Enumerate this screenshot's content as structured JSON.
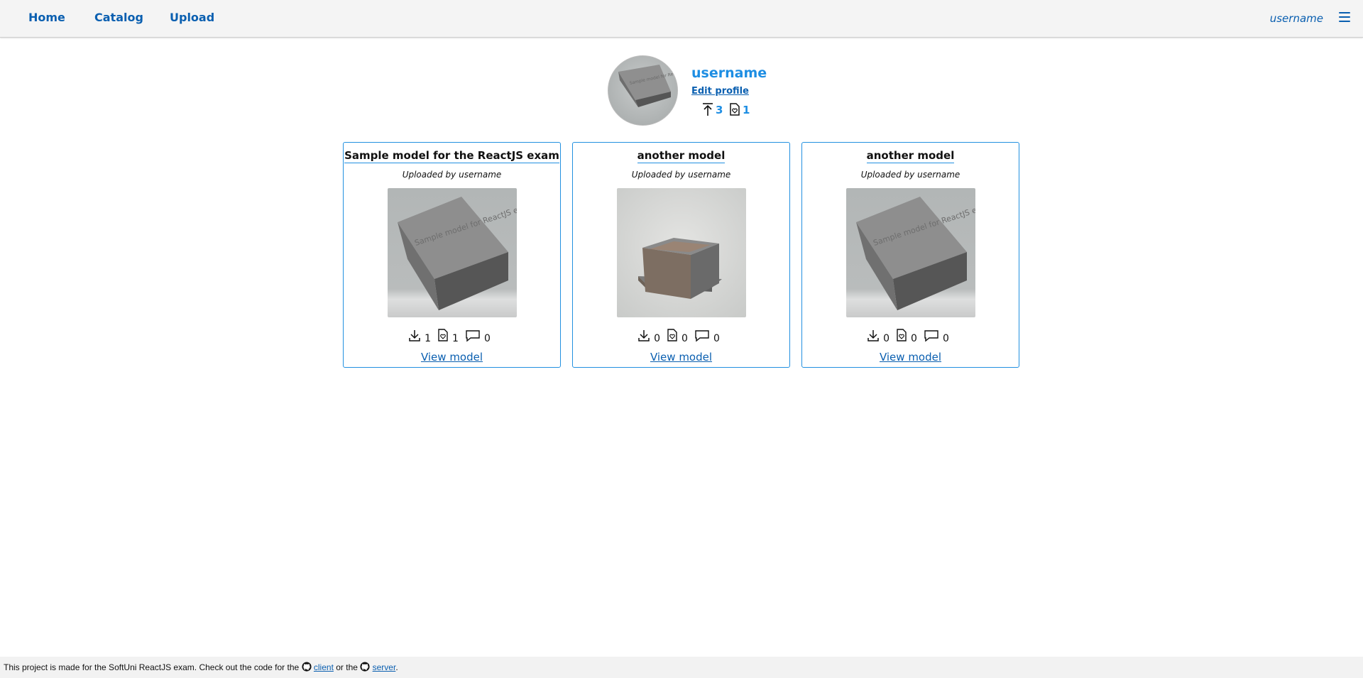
{
  "nav": {
    "home": "Home",
    "catalog": "Catalog",
    "upload": "Upload",
    "username": "username",
    "menu_icon": "hamburger-icon"
  },
  "profile": {
    "name": "username",
    "edit_label": "Edit profile",
    "uploads_count": "3",
    "likes_count": "1",
    "avatar_text": "Sample model for ReactJS exam"
  },
  "cards": [
    {
      "title": "Sample model for the ReactJS exam",
      "uploaded_by": "Uploaded by username",
      "thumb_text": "Sample model for ReactJS exam",
      "downloads": "1",
      "likes": "1",
      "comments": "0",
      "link": "View model"
    },
    {
      "title": "another model",
      "uploaded_by": "Uploaded by username",
      "downloads": "0",
      "likes": "0",
      "comments": "0",
      "link": "View model"
    },
    {
      "title": "another model",
      "uploaded_by": "Uploaded by username",
      "thumb_text": "Sample model for ReactJS exam",
      "downloads": "0",
      "likes": "0",
      "comments": "0",
      "link": "View model"
    }
  ],
  "footer": {
    "text_before": "This project is made for the SoftUni ReactJS exam. Check out the code for the",
    "client": "client",
    "middle": "or the",
    "server": "server",
    "end": "."
  },
  "colors": {
    "accent": "#1e8ee3",
    "link": "#0a5fb0",
    "card_border": "#2290e0"
  }
}
